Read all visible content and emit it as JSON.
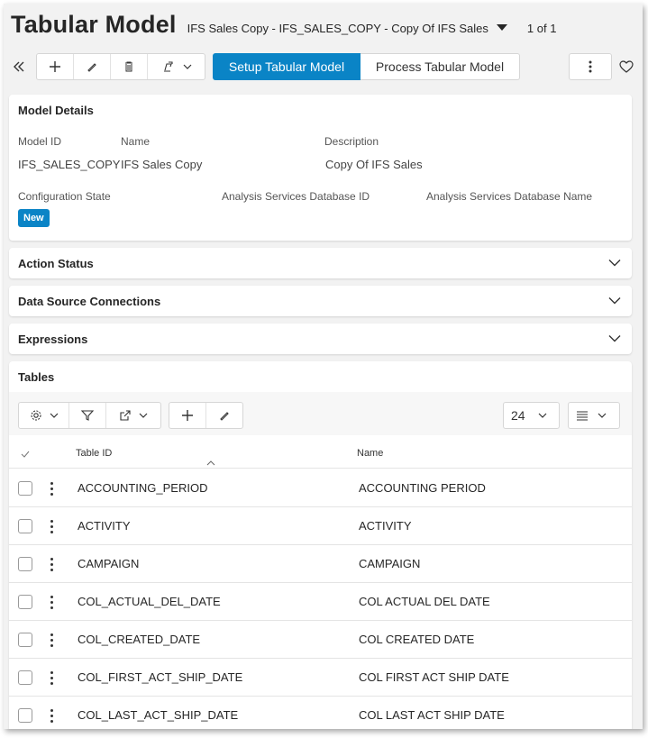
{
  "header": {
    "title": "Tabular Model",
    "record_description": "IFS Sales Copy - IFS_SALES_COPY - Copy Of IFS Sales",
    "record_count": "1 of 1"
  },
  "toolbar": {
    "setup_label": "Setup Tabular Model",
    "process_label": "Process Tabular Model"
  },
  "model_details": {
    "title": "Model Details",
    "model_id_label": "Model ID",
    "model_id_value": "IFS_SALES_COPY",
    "name_label": "Name",
    "name_value": "IFS Sales Copy",
    "description_label": "Description",
    "description_value": "Copy Of IFS Sales",
    "config_state_label": "Configuration State",
    "config_state_value": "New",
    "as_db_id_label": "Analysis Services Database ID",
    "as_db_name_label": "Analysis Services Database Name"
  },
  "sections": {
    "action_status": "Action Status",
    "data_source_connections": "Data Source Connections",
    "expressions": "Expressions"
  },
  "tables": {
    "title": "Tables",
    "page_size": "24",
    "columns": {
      "table_id": "Table ID",
      "name": "Name"
    },
    "rows": [
      {
        "table_id": "ACCOUNTING_PERIOD",
        "name": "ACCOUNTING PERIOD"
      },
      {
        "table_id": "ACTIVITY",
        "name": "ACTIVITY"
      },
      {
        "table_id": "CAMPAIGN",
        "name": "CAMPAIGN"
      },
      {
        "table_id": "COL_ACTUAL_DEL_DATE",
        "name": "COL ACTUAL DEL DATE"
      },
      {
        "table_id": "COL_CREATED_DATE",
        "name": "COL CREATED DATE"
      },
      {
        "table_id": "COL_FIRST_ACT_SHIP_DATE",
        "name": "COL FIRST ACT SHIP DATE"
      },
      {
        "table_id": "COL_LAST_ACT_SHIP_DATE",
        "name": "COL LAST ACT SHIP DATE"
      }
    ]
  },
  "colors": {
    "accent": "#0a84c6",
    "background": "#f2f2f2"
  }
}
